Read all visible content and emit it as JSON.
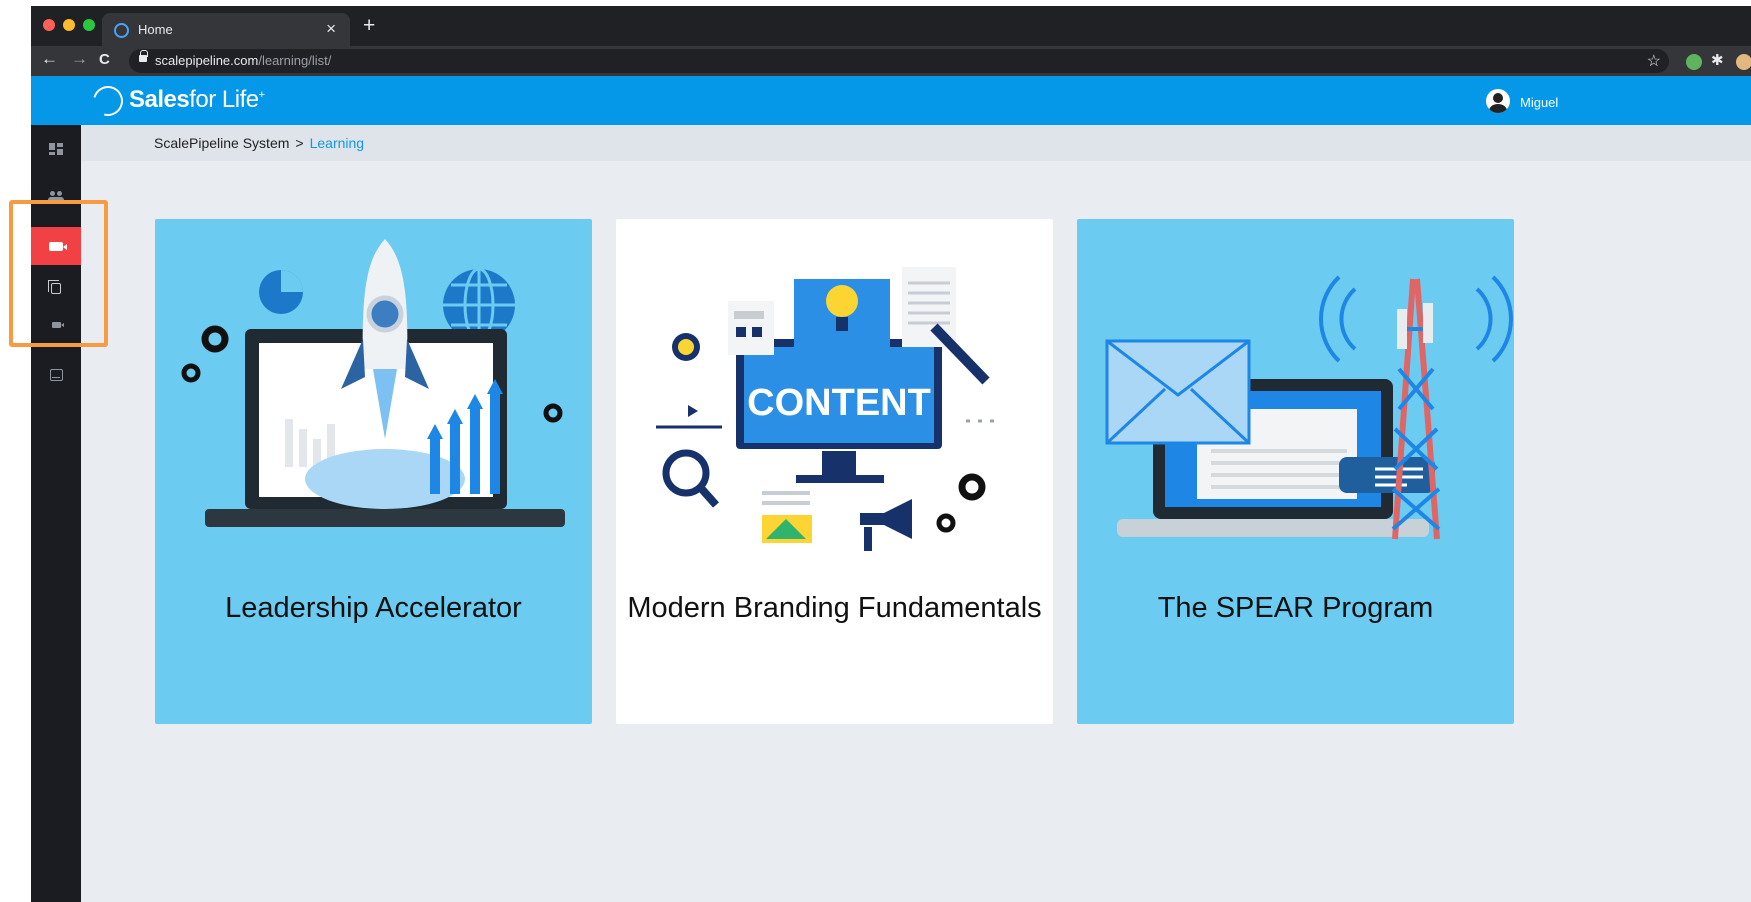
{
  "browser": {
    "tab_title": "Home",
    "tab_close": "×",
    "new_tab": "+",
    "url_host": "scalepipeline.com",
    "url_path": "/learning/list/",
    "back": "←",
    "forward": "→",
    "reload": "C",
    "star": "☆"
  },
  "app": {
    "logo_bold": "Sales",
    "logo_light": "for Life",
    "logo_mark": "+",
    "user_name": "Miguel",
    "header_color": "#0597e8"
  },
  "breadcrumb": {
    "root": "ScalePipeline System",
    "separator": ">",
    "current": "Learning"
  },
  "sidebar": {
    "items": [
      {
        "icon": "dashboard-icon",
        "active": false
      },
      {
        "icon": "people-icon",
        "active": false
      },
      {
        "icon": "video-camera-icon",
        "active": true
      },
      {
        "icon": "copy-icon",
        "active": false
      },
      {
        "icon": "camera-icon",
        "active": false
      },
      {
        "icon": "inbox-icon",
        "active": false
      }
    ],
    "active_color": "#f14145"
  },
  "courses": [
    {
      "title": "Leadership Accelerator",
      "image": "rocket-laptop-illustration",
      "bg": "#6ccbf1"
    },
    {
      "title": "Modern Branding Fundamentals",
      "image": "content-monitor-illustration",
      "bg": "#ffffff",
      "art_text": "CONTENT"
    },
    {
      "title": "The SPEAR Program",
      "image": "email-tower-illustration",
      "bg": "#6ccbf1"
    }
  ]
}
